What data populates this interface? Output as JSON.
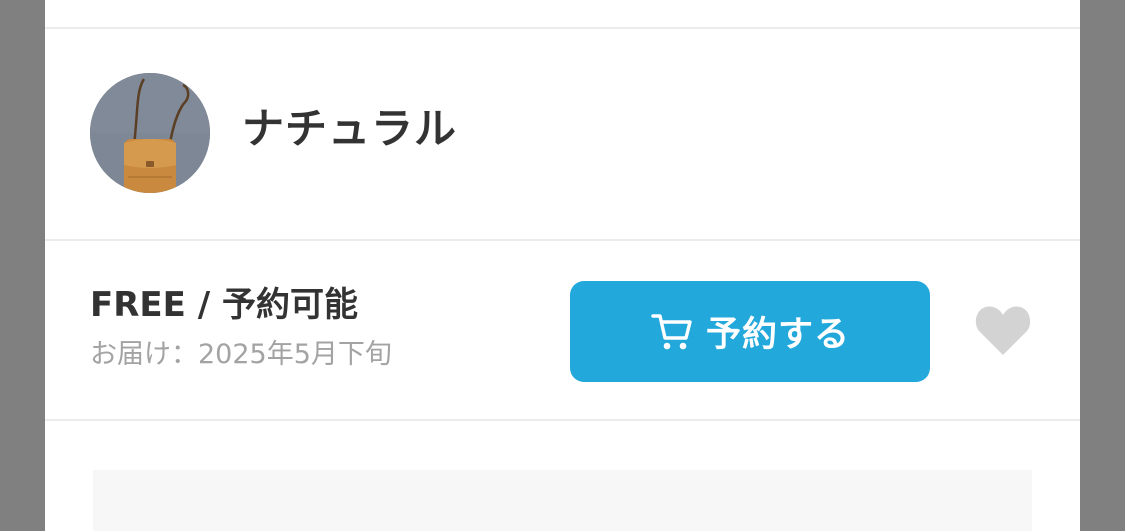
{
  "variant": {
    "name": "ナチュラル",
    "image": "tan-leather-shoulder-bag"
  },
  "purchase": {
    "price_status": "FREE / 予約可能",
    "delivery": "お届け：2025年5月下旬",
    "reserve_label": "予約する",
    "reserve_icon": "cart-icon",
    "favorite_icon": "heart-icon"
  },
  "colors": {
    "accent": "#23a8dc",
    "favorite_inactive": "#d3d3d3",
    "overlay": "#808080"
  }
}
